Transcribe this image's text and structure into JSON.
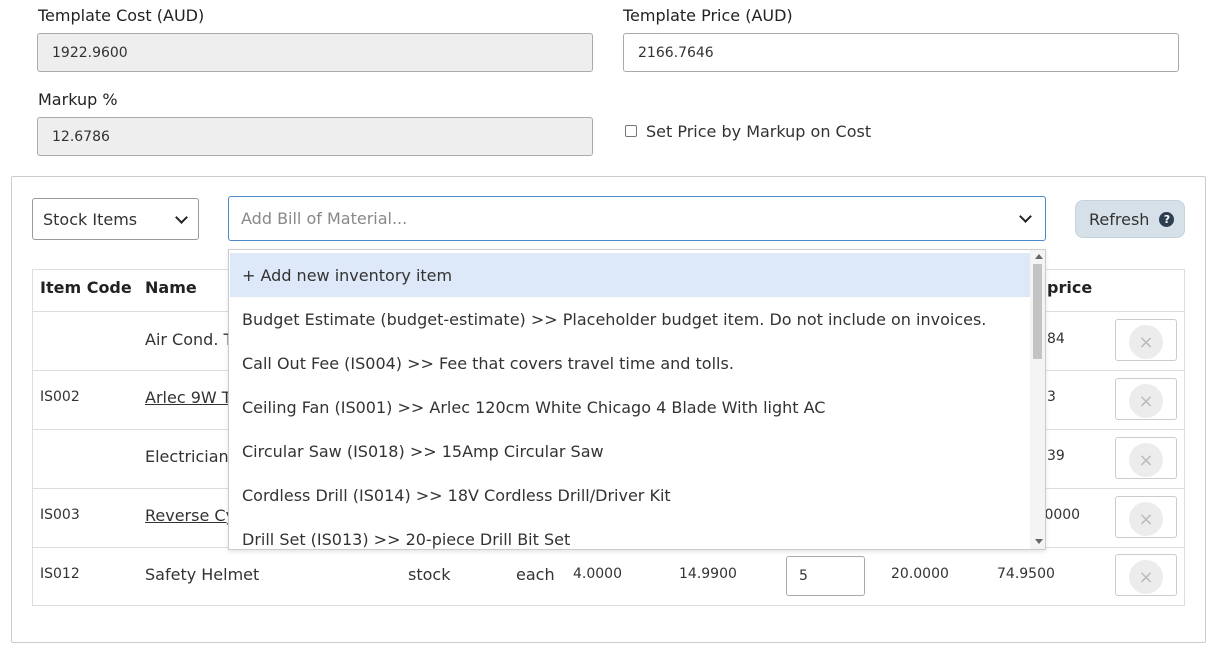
{
  "template_cost": {
    "label": "Template Cost (AUD)",
    "value": "1922.9600"
  },
  "template_price": {
    "label": "Template Price (AUD)",
    "value": "2166.7646"
  },
  "markup": {
    "label": "Markup %",
    "value": "12.6786"
  },
  "set_price_checkbox": {
    "label": "Set Price by Markup on Cost",
    "checked": false
  },
  "item_type_select": {
    "value": "Stock Items"
  },
  "bom_select": {
    "placeholder": "Add Bill of Material..."
  },
  "refresh_button": {
    "label": "Refresh",
    "help": "?"
  },
  "table": {
    "headers": {
      "item_code": "Item Code",
      "name": "Name",
      "price_partial": "price"
    },
    "rows": [
      {
        "code": "",
        "name": "Air Cond. T",
        "total_partial": "84"
      },
      {
        "code": "IS002",
        "name": "Arlec 9W T",
        "total_partial": "3"
      },
      {
        "code": "",
        "name": "Electrician",
        "total_partial": "39"
      },
      {
        "code": "IS003",
        "name": "Reverse Cy",
        "total_partial": ".0000"
      },
      {
        "code": "IS012",
        "name": "Safety Helmet",
        "type": "stock",
        "unit": "each",
        "cost": "4.0000",
        "price": "14.9900",
        "qty": "5",
        "total_cost": "20.0000",
        "total_price": "74.9500"
      }
    ],
    "delete_icon": "×"
  },
  "dropdown": {
    "options": [
      "+ Add new inventory item",
      "Budget Estimate (budget-estimate) >> Placeholder budget item. Do not include on invoices.",
      "Call Out Fee (IS004) >> Fee that covers travel time and tolls.",
      "Ceiling Fan (IS001) >> Arlec 120cm White Chicago 4 Blade With light AC",
      "Circular Saw (IS018) >> 15Amp Circular Saw",
      "Cordless Drill (IS014) >> 18V Cordless Drill/Driver Kit",
      "Drill Set (IS013) >> 20-piece Drill Bit Set"
    ]
  },
  "icons": {
    "select_chevron": "chevron-down-icon",
    "help": "help-circle-icon",
    "delete": "close-icon"
  },
  "colors": {
    "focus_border": "#4a8ac9",
    "highlight": "#dde8f8",
    "refresh_bg": "#d6e0e8"
  }
}
